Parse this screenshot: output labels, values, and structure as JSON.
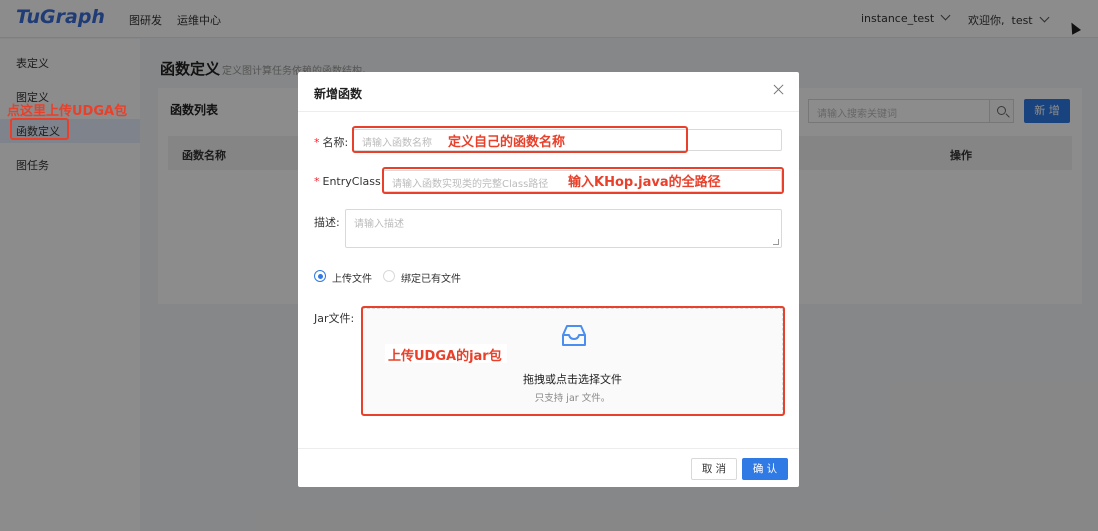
{
  "app": {
    "logo": "TuGraph"
  },
  "header": {
    "nav": [
      "图研发",
      "运维中心"
    ],
    "instance": "instance_test",
    "welcome": "欢迎你,",
    "user": "test"
  },
  "sidebar": {
    "items": [
      {
        "label": "表定义"
      },
      {
        "label": "图定义"
      },
      {
        "label": "函数定义",
        "active": true
      },
      {
        "label": "图任务"
      }
    ]
  },
  "main": {
    "title": "函数定义",
    "subtitle": "定义图计算任务依赖的函数结构。",
    "card_title": "函数列表",
    "search_placeholder": "请输入搜索关键词",
    "add_label": "新 增",
    "columns": [
      "函数名称",
      "操作"
    ]
  },
  "modal": {
    "title": "新增函数",
    "name_label": "名称:",
    "name_placeholder": "请输入函数名称",
    "entry_label": "EntryClass:",
    "entry_placeholder": "请输入函数实现类的完整Class路径",
    "desc_label": "描述:",
    "desc_placeholder": "请输入描述",
    "radio_upload": "上传文件",
    "radio_bind": "绑定已有文件",
    "jar_label": "Jar文件:",
    "drop_main": "拖拽或点击选择文件",
    "drop_sub": "只支持 jar 文件。",
    "cancel": "取 消",
    "ok": "确 认"
  },
  "annotations": {
    "sidebar_note": "点这里上传UDGA包",
    "name_note": "定义自己的函数名称",
    "entry_note": "输入KHop.java的全路径",
    "jar_note": "上传UDGA的jar包"
  },
  "colors": {
    "accent": "#2f7ae5",
    "annotation": "#e8402a"
  }
}
